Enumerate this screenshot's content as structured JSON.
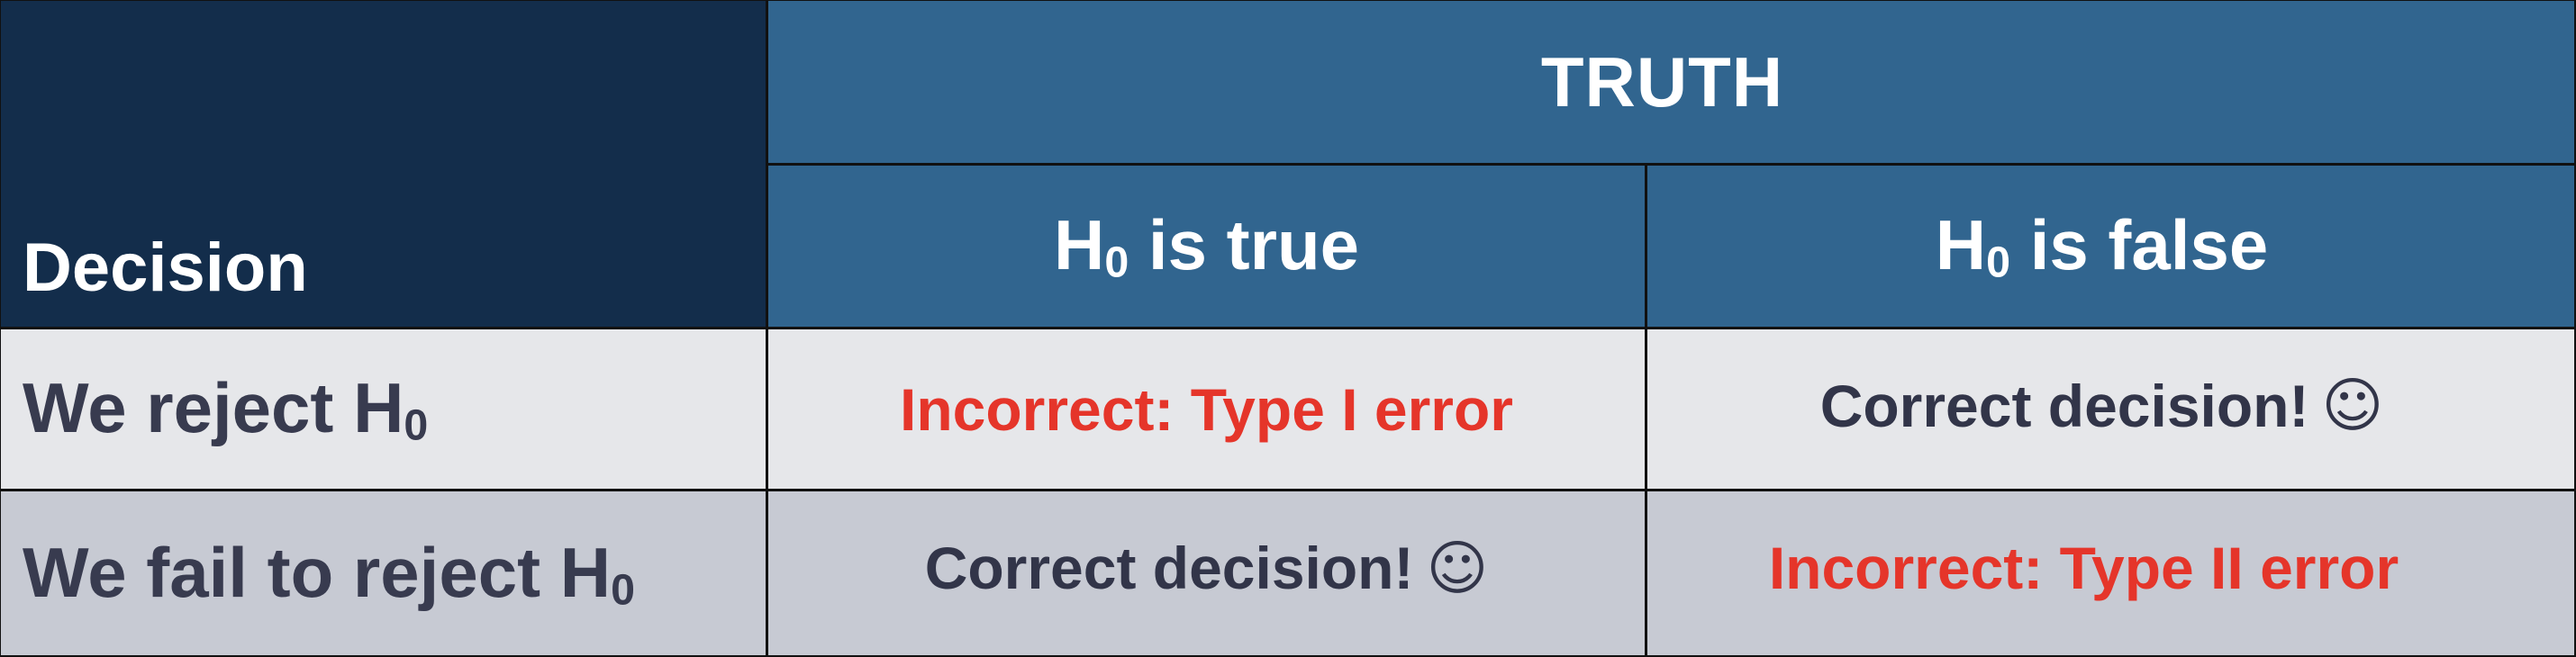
{
  "table": {
    "corner_label": "Decision",
    "truth_header": "TRUTH",
    "columns": [
      {
        "prefix": "H",
        "subscript": "0",
        "suffix": " is true"
      },
      {
        "prefix": "H",
        "subscript": "0",
        "suffix": " is false"
      }
    ],
    "rows": [
      {
        "label_prefix": "We reject H",
        "label_subscript": "0",
        "cells": [
          {
            "text": "Incorrect: Type I error",
            "emoji": ""
          },
          {
            "text": "Correct decision!",
            "emoji": "☺"
          }
        ]
      },
      {
        "label_prefix": "We fail to reject H",
        "label_subscript": "0",
        "cells": [
          {
            "text": "Correct decision!",
            "emoji": "☺"
          },
          {
            "text": "Incorrect: Type II error",
            "emoji": ""
          }
        ]
      }
    ]
  },
  "colors": {
    "corner_bg": "#132d4b",
    "header_bg": "#31658f",
    "row1_bg": "#e6e7ea",
    "row2_bg": "#c7cad3",
    "error_text": "#e5352a",
    "correct_text": "#323549"
  },
  "icons": {
    "smiley": "smiley-face-icon"
  }
}
